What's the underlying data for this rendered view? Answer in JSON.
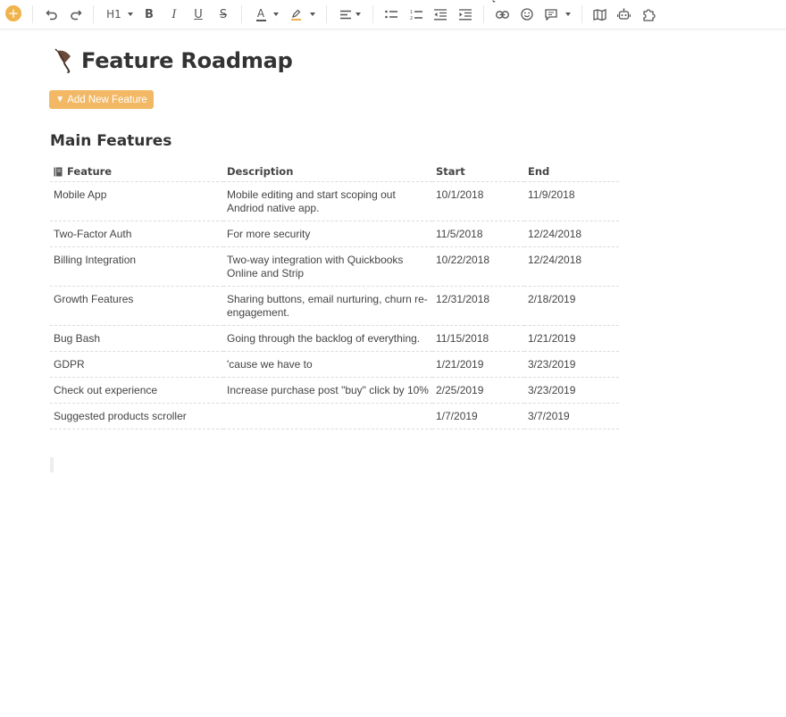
{
  "toolbar": {
    "items": [
      {
        "name": "add-block-button",
        "icon": "plus-icon"
      },
      {
        "name": "undo-button",
        "icon": "undo-icon"
      },
      {
        "name": "redo-button",
        "icon": "redo-icon"
      },
      {
        "name": "heading-button",
        "icon": "heading-icon",
        "label": "H1"
      },
      {
        "name": "bold-button",
        "icon": "bold-icon",
        "label": "B"
      },
      {
        "name": "italic-button",
        "icon": "italic-icon",
        "label": "I"
      },
      {
        "name": "underline-button",
        "icon": "underline-icon",
        "label": "U"
      },
      {
        "name": "strikethrough-button",
        "icon": "strikethrough-icon",
        "label": "S"
      },
      {
        "name": "text-color-button",
        "icon": "text-color-icon",
        "label": "A"
      },
      {
        "name": "highlight-button",
        "icon": "highlighter-icon"
      },
      {
        "name": "align-button",
        "icon": "align-left-icon"
      },
      {
        "name": "bullet-list-button",
        "icon": "bullet-list-icon"
      },
      {
        "name": "numbered-list-button",
        "icon": "numbered-list-icon"
      },
      {
        "name": "outdent-button",
        "icon": "outdent-icon"
      },
      {
        "name": "indent-button",
        "icon": "indent-icon"
      },
      {
        "name": "link-button",
        "icon": "link-icon"
      },
      {
        "name": "emoji-button",
        "icon": "smiley-icon"
      },
      {
        "name": "comment-button",
        "icon": "comment-icon"
      },
      {
        "name": "map-button",
        "icon": "map-icon"
      },
      {
        "name": "bot-button",
        "icon": "robot-icon"
      },
      {
        "name": "plugin-button",
        "icon": "puzzle-icon"
      }
    ],
    "accent_color": "#f0b24c"
  },
  "page": {
    "emoji": "umbrella-emoji",
    "title": "Feature Roadmap",
    "add_button_label": "Add New Feature",
    "add_button_color": "#f2b865",
    "section_heading": "Main Features"
  },
  "table": {
    "headers": [
      "Feature",
      "Description",
      "Start",
      "End"
    ],
    "rows": [
      {
        "feature": "Mobile App",
        "description": "Mobile editing and start scoping out Andriod native app.",
        "start": "10/1/2018",
        "end": "11/9/2018"
      },
      {
        "feature": "Two-Factor Auth",
        "description": "For more security",
        "start": "11/5/2018",
        "end": "12/24/2018"
      },
      {
        "feature": "Billing Integration",
        "description": "Two-way integration with Quickbooks Online and Strip",
        "start": "10/22/2018",
        "end": "12/24/2018"
      },
      {
        "feature": "Growth Features",
        "description": "Sharing buttons, email nurturing, churn re-engagement.",
        "start": "12/31/2018",
        "end": "2/18/2019"
      },
      {
        "feature": "Bug Bash",
        "description": "Going through the backlog of everything.",
        "start": "11/15/2018",
        "end": "1/21/2019"
      },
      {
        "feature": "GDPR",
        "description": "'cause we have to",
        "start": "1/21/2019",
        "end": "3/23/2019"
      },
      {
        "feature": "Check out experience",
        "description": "Increase purchase post \"buy\" click by 10%",
        "start": "2/25/2019",
        "end": "3/23/2019"
      },
      {
        "feature": "Suggested products scroller",
        "description": "",
        "start": "1/7/2019",
        "end": "3/7/2019"
      }
    ]
  }
}
